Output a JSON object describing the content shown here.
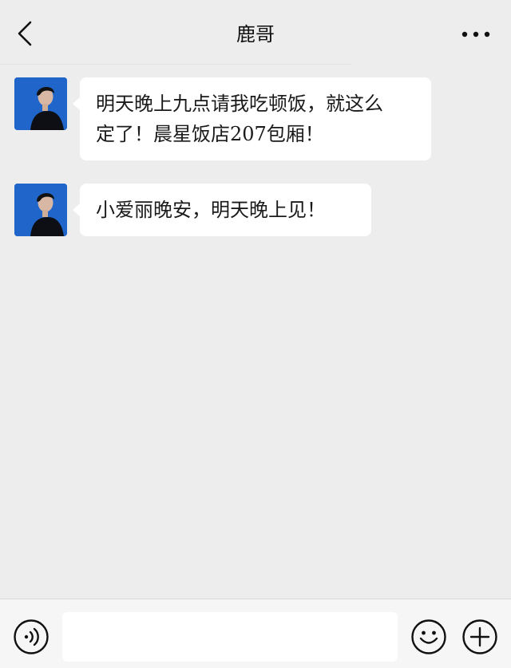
{
  "header": {
    "title": "鹿哥",
    "back_icon": "chevron-left-icon",
    "more_icon": "more-dots-icon"
  },
  "messages": [
    {
      "sender": "鹿哥",
      "avatar_icon": "avatar-photo",
      "lines": [
        "明天晚上九点请我吃顿饭，就这么",
        "定了！晨星饭店207包厢！"
      ]
    },
    {
      "sender": "鹿哥",
      "avatar_icon": "avatar-photo",
      "lines": [
        "小爱丽晚安，明天晚上见！"
      ]
    }
  ],
  "input_bar": {
    "voice_icon": "voice-icon",
    "text_value": "",
    "emoji_icon": "emoji-icon",
    "plus_icon": "plus-icon"
  },
  "colors": {
    "background": "#ededed",
    "bubble": "#ffffff",
    "avatar_bg": "#1a5fc4",
    "input_bar": "#f6f6f6"
  }
}
